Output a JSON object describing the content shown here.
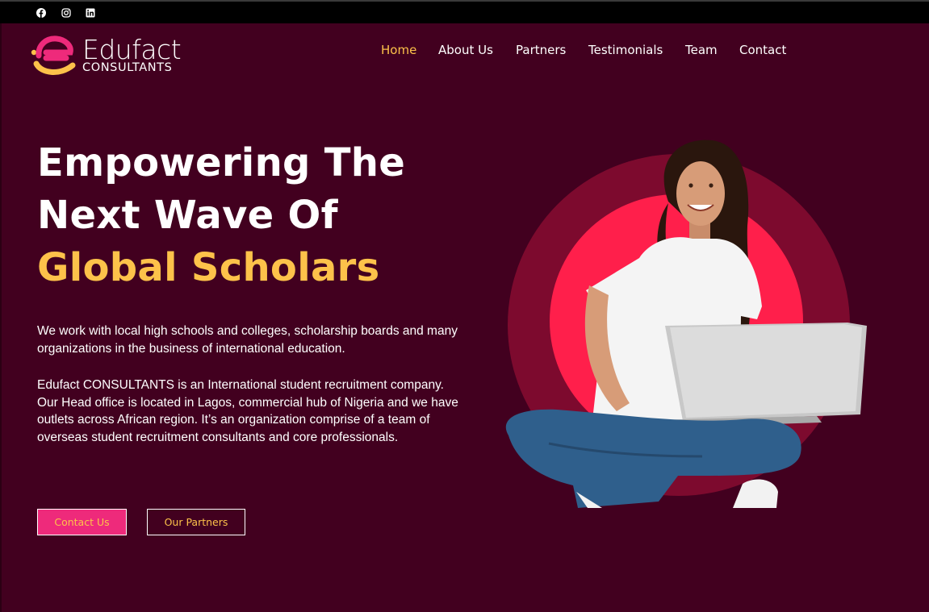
{
  "topbar": {
    "social": [
      {
        "icon": "facebook-icon"
      },
      {
        "icon": "instagram-icon"
      },
      {
        "icon": "linkedin-icon"
      }
    ]
  },
  "logo": {
    "word": "Edufact",
    "sub": "CONSULTANTS",
    "colors": {
      "pink": "#ee2a7b",
      "yellow": "#fdc24a"
    }
  },
  "nav": {
    "items": [
      {
        "label": "Home",
        "active": true
      },
      {
        "label": "About Us"
      },
      {
        "label": "Partners"
      },
      {
        "label": "Testimonials"
      },
      {
        "label": "Team"
      },
      {
        "label": "Contact"
      }
    ]
  },
  "hero": {
    "title_line1": "Empowering The",
    "title_line2": "Next Wave Of",
    "title_line3": "Global Scholars",
    "para1": "We work with local high schools and colleges, scholarship boards and many organizations in the business of international education.",
    "para2": "Edufact CONSULTANTS is an International student recruitment company. Our Head office is located in Lagos, commercial hub of Nigeria and we have outlets across African region. It’s an organization comprise of a team of overseas student recruitment consultants and core professionals.",
    "btn_contact": "Contact Us",
    "btn_partners": "Our Partners"
  },
  "colors": {
    "background": "#42001f",
    "accent_yellow": "#fdc24a",
    "accent_pink": "#ee2a7b",
    "circle_outer": "#7d0a2e",
    "circle_inner": "#ff1f4b"
  }
}
